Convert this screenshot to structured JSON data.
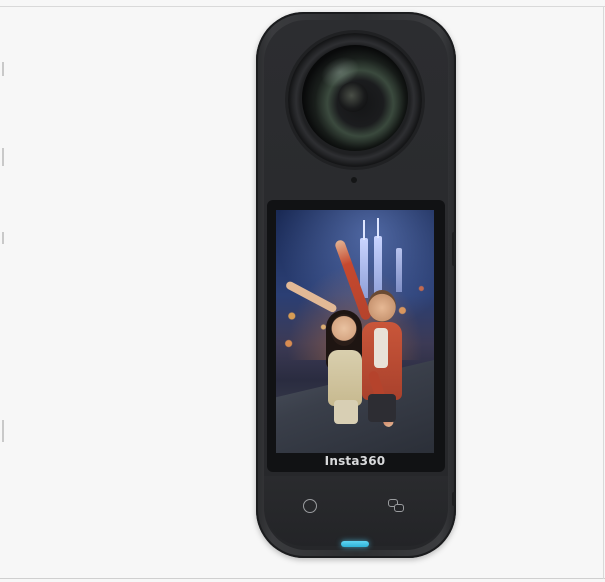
{
  "product": {
    "brand_text": "Insta360",
    "colors": {
      "body": "#2e2f31",
      "led_accent": "#2fb3d8",
      "background": "#f7f7f7"
    }
  },
  "icons": {
    "shutter_button": "circle-icon",
    "mode_button": "switch-camera-icon"
  }
}
